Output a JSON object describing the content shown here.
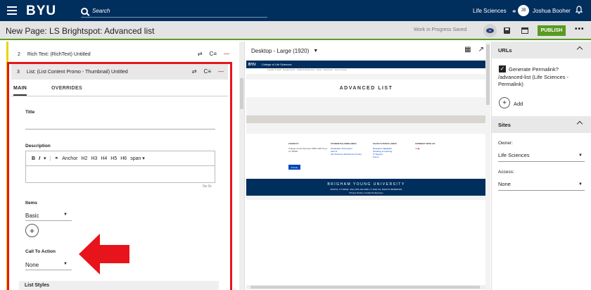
{
  "topnav": {
    "brand": "BYU",
    "search_label": "Search",
    "site_name": "Life Sciences",
    "avatar_initials": "JB",
    "username": "Joshua Booher"
  },
  "header": {
    "title": "New Page: LS Brightspot: Advanced list",
    "status": "Work in Progress Saved",
    "publish_label": "PUBLISH",
    "more_label": "•••"
  },
  "editor": {
    "rows": [
      {
        "num": "2",
        "label": "Rich Text: (RichText) Untitled"
      },
      {
        "num": "3",
        "label": "List: (List Content Promo - Thumbnail) Untitled"
      }
    ],
    "row_actions": {
      "move": "⇄",
      "collapse": "C≡",
      "delete": "—"
    },
    "tabs": [
      "MAIN",
      "OVERRIDES"
    ],
    "title_label": "Title",
    "description_label": "Description",
    "rte": {
      "bold": "B",
      "italic": "I",
      "more": "▾",
      "link": "⚭",
      "anchor": "Anchor",
      "h2": "H2",
      "h3": "H3",
      "h4": "H4",
      "h5": "H5",
      "h6": "H6",
      "span": "span ▾"
    },
    "char_count": "0w 0c",
    "items_label": "Items",
    "items_value": "Basic",
    "add_symbol": "+",
    "cta_label": "Call To Action",
    "cta_value": "None",
    "list_styles_label": "List Styles"
  },
  "preview": {
    "device": "Desktop - Large (1920)",
    "site": {
      "brand": "BYU",
      "college": "College of Life Sciences",
      "nav": "Faculty & Staff · Departments · Student Resources · News · Research · Get Involved",
      "hero": "ADVANCED LIST",
      "footer_cols": [
        {
          "title": "CONTACT",
          "text": "College of Life Sciences 5050 LSB Provo, UT 84602"
        },
        {
          "title": "STUDENT/ALUMNI LINKS",
          "text": "Graduation Information\nAlumni\nLife Sciences Advisement Center"
        },
        {
          "title": "FACULTY/STAFF LINKS",
          "text": "Research Highlights\nTeaching & Learning\nIT Support\nForms"
        },
        {
          "title": "CONNECT WITH US",
          "text": "f ● ▶"
        }
      ],
      "donate": "Donate",
      "university": "BRIGHAM YOUNG UNIVERSITY",
      "bottom_line": "PROVO, UT 84602, USA | 801-422-4636 | © 2022 ALL RIGHTS RESERVED",
      "bottom_line2": "Privacy Notice | Cookie Preferences"
    }
  },
  "sidebar": {
    "urls_header": "URLs",
    "generate_label": "Generate Permalink?",
    "permalink": "/advanced-list (Life Sciences - Permalink)",
    "add_label": "Add",
    "sites_header": "Sites",
    "owner_label": "Owner:",
    "owner_value": "Life Sciences",
    "access_label": "Access:",
    "access_value": "None"
  },
  "colors": {
    "nav": "#002e5d",
    "publish": "#5a9a23",
    "annotation": "#e8141b",
    "highlight_bar": "#e8d600"
  }
}
